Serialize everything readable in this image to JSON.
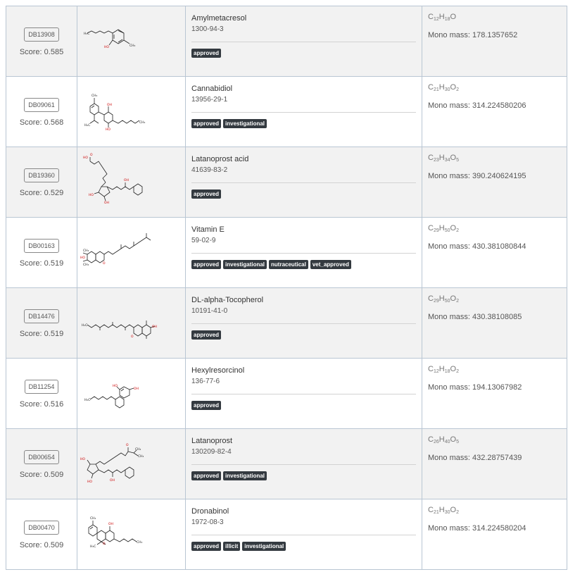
{
  "rows": [
    {
      "id": "DB13908",
      "score": "Score: 0.585",
      "name": "Amylmetacresol",
      "cas": "1300-94-3",
      "badges": [
        "approved"
      ],
      "formula": [
        [
          "C",
          "12"
        ],
        [
          "H",
          "18"
        ],
        [
          "O",
          ""
        ]
      ],
      "mass": "Mono mass: 178.1357652"
    },
    {
      "id": "DB09061",
      "score": "Score: 0.568",
      "name": "Cannabidiol",
      "cas": "13956-29-1",
      "badges": [
        "approved",
        "investigational"
      ],
      "formula": [
        [
          "C",
          "21"
        ],
        [
          "H",
          "30"
        ],
        [
          "O",
          "2"
        ]
      ],
      "mass": "Mono mass: 314.224580206"
    },
    {
      "id": "DB19360",
      "score": "Score: 0.529",
      "name": "Latanoprost acid",
      "cas": "41639-83-2",
      "badges": [
        "approved"
      ],
      "formula": [
        [
          "C",
          "23"
        ],
        [
          "H",
          "34"
        ],
        [
          "O",
          "5"
        ]
      ],
      "mass": "Mono mass: 390.240624195"
    },
    {
      "id": "DB00163",
      "score": "Score: 0.519",
      "name": "Vitamin E",
      "cas": "59-02-9",
      "badges": [
        "approved",
        "investigational",
        "nutraceutical",
        "vet_approved"
      ],
      "formula": [
        [
          "C",
          "29"
        ],
        [
          "H",
          "50"
        ],
        [
          "O",
          "2"
        ]
      ],
      "mass": "Mono mass: 430.381080844"
    },
    {
      "id": "DB14476",
      "score": "Score: 0.519",
      "name": "DL-alpha-Tocopherol",
      "cas": "10191-41-0",
      "badges": [
        "approved"
      ],
      "formula": [
        [
          "C",
          "29"
        ],
        [
          "H",
          "50"
        ],
        [
          "O",
          "2"
        ]
      ],
      "mass": "Mono mass: 430.38108085"
    },
    {
      "id": "DB11254",
      "score": "Score: 0.516",
      "name": "Hexylresorcinol",
      "cas": "136-77-6",
      "badges": [
        "approved"
      ],
      "formula": [
        [
          "C",
          "12"
        ],
        [
          "H",
          "18"
        ],
        [
          "O",
          "2"
        ]
      ],
      "mass": "Mono mass: 194.13067982"
    },
    {
      "id": "DB00654",
      "score": "Score: 0.509",
      "name": "Latanoprost",
      "cas": "130209-82-4",
      "badges": [
        "approved",
        "investigational"
      ],
      "formula": [
        [
          "C",
          "26"
        ],
        [
          "H",
          "40"
        ],
        [
          "O",
          "5"
        ]
      ],
      "mass": "Mono mass: 432.28757439"
    },
    {
      "id": "DB00470",
      "score": "Score: 0.509",
      "name": "Dronabinol",
      "cas": "1972-08-3",
      "badges": [
        "approved",
        "illicit",
        "investigational"
      ],
      "formula": [
        [
          "C",
          "21"
        ],
        [
          "H",
          "30"
        ],
        [
          "O",
          "2"
        ]
      ],
      "mass": "Mono mass: 314.224580204"
    }
  ]
}
